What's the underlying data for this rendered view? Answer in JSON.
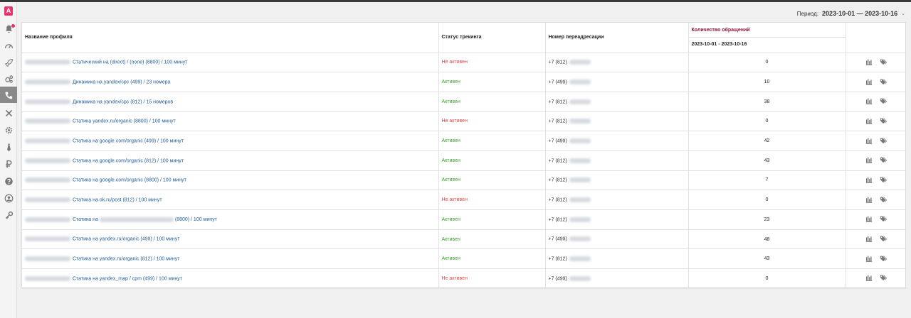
{
  "period": {
    "label": "Период:",
    "value": "2023-10-01 — 2023-10-16"
  },
  "table": {
    "headers": {
      "name": "Название профиля",
      "status": "Статус трекинга",
      "number": "Номер переадресации",
      "calls": "Количество обращений",
      "calls_range": "2023-10-01 - 2023-10-16"
    },
    "rows": [
      {
        "name": "Статический на (direct) / (none) (8800) / 100 минут",
        "status": "Не активен",
        "phone": "+7 (812)",
        "calls": "0"
      },
      {
        "name": "Динамика на yandex/cpc (499) / 23 номера",
        "status": "Активен",
        "phone": "+7 (499)",
        "calls": "10"
      },
      {
        "name": "Динамика на yandex/cpc (812) / 15 номеров",
        "status": "Активен",
        "phone": "+7 (812)",
        "calls": "38"
      },
      {
        "name": "Статика yandex.ru/organic (8800) / 100 минут",
        "status": "Не активен",
        "phone": "+7 (812)",
        "calls": "0"
      },
      {
        "name": "Статика на google.com/organic (499) / 100 минут",
        "status": "Активен",
        "phone": "+7 (499)",
        "calls": "42"
      },
      {
        "name": "Статика на google.com/organic (812) / 100 минут",
        "status": "Активен",
        "phone": "+7 (812)",
        "calls": "43"
      },
      {
        "name": "Статика на google.com/organic (8800) / 100 минут",
        "status": "Активен",
        "phone": "+7 (812)",
        "calls": "7"
      },
      {
        "name": "Статика на ok.ru/post (812) / 100 минут",
        "status": "Не активен",
        "phone": "+7 (812)",
        "calls": "0"
      },
      {
        "name_prefix": "Статика на",
        "name_suffix": "(8800) / 100 минут",
        "status": "Активен",
        "phone": "+7 (812)",
        "calls": "23"
      },
      {
        "name": "Статика на yandex.ru/organic (499) / 100 минут",
        "status": "Активен",
        "phone": "+7 (499)",
        "calls": "48"
      },
      {
        "name": "Статика на yandex.ru/organic (812) / 100 минут",
        "status": "Активен",
        "phone": "+7 (812)",
        "calls": "43"
      },
      {
        "name": "Статика на yandex_map / cpm (499) / 100 минут",
        "status": "Не активен",
        "phone": "+7 (499)",
        "calls": "0"
      }
    ]
  },
  "colors": {
    "accent": "#e8336d",
    "active": "#3d9e2e",
    "inactive": "#e04646",
    "link": "#1f5d99",
    "calls_header": "#8b1538"
  },
  "sidebar_icons": [
    "logo-icon",
    "bell-icon",
    "gauge-icon",
    "rocket-icon",
    "cogs-icon",
    "phone-icon",
    "tools-icon",
    "gear-icon",
    "tie-icon",
    "ruble-icon",
    "help-icon",
    "user-icon",
    "key-icon"
  ]
}
